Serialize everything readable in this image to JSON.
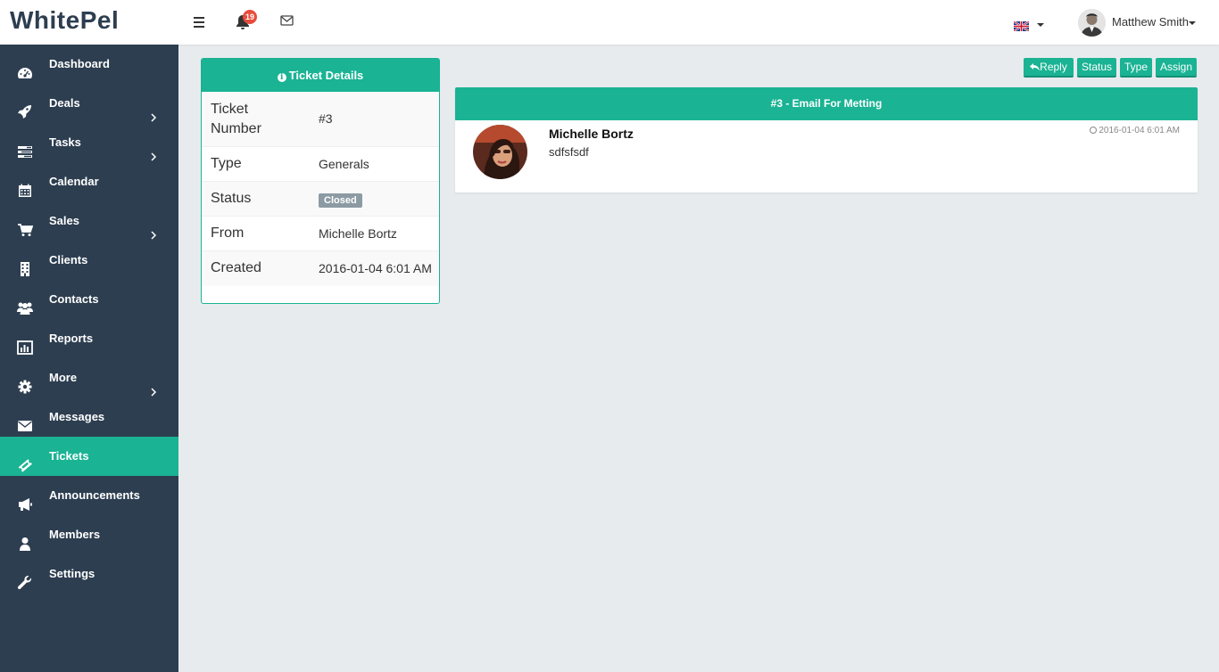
{
  "app": {
    "brand": "WhitePel",
    "notification_count": "19",
    "user_name": "Matthew Smith",
    "accent_color": "#1ab394",
    "sidebar_color": "#2d3e50"
  },
  "sidebar": {
    "items": [
      {
        "label": "Dashboard",
        "icon": "dashboard-icon",
        "has_submenu": false
      },
      {
        "label": "Deals",
        "icon": "rocket-icon",
        "has_submenu": true
      },
      {
        "label": "Tasks",
        "icon": "tasks-icon",
        "has_submenu": true
      },
      {
        "label": "Calendar",
        "icon": "calendar-icon",
        "has_submenu": false
      },
      {
        "label": "Sales",
        "icon": "cart-icon",
        "has_submenu": true
      },
      {
        "label": "Clients",
        "icon": "building-icon",
        "has_submenu": false
      },
      {
        "label": "Contacts",
        "icon": "users-icon",
        "has_submenu": false
      },
      {
        "label": "Reports",
        "icon": "bar-chart-icon",
        "has_submenu": false
      },
      {
        "label": "More",
        "icon": "gear-icon",
        "has_submenu": true
      },
      {
        "label": "Messages",
        "icon": "envelope-icon",
        "has_submenu": false
      },
      {
        "label": "Tickets",
        "icon": "ticket-icon",
        "has_submenu": false,
        "active": true
      },
      {
        "label": "Announcements",
        "icon": "bullhorn-icon",
        "has_submenu": false
      },
      {
        "label": "Members",
        "icon": "user-icon",
        "has_submenu": false
      },
      {
        "label": "Settings",
        "icon": "wrench-icon",
        "has_submenu": false
      }
    ]
  },
  "details": {
    "title": "Ticket Details",
    "rows": [
      {
        "label": "Ticket Number",
        "value": "#3"
      },
      {
        "label": "Type",
        "value": "Generals"
      },
      {
        "label": "Status",
        "value": "Closed"
      },
      {
        "label": "From",
        "value": "Michelle Bortz"
      },
      {
        "label": "Created",
        "value": "2016-01-04 6:01 AM"
      }
    ]
  },
  "actions": {
    "reply": "Reply",
    "status": "Status",
    "type": "Type",
    "assign": "Assign"
  },
  "message": {
    "title": "#3 - Email For Metting",
    "author": "Michelle Bortz",
    "body": "sdfsfsdf",
    "time": "2016-01-04 6:01 AM"
  }
}
